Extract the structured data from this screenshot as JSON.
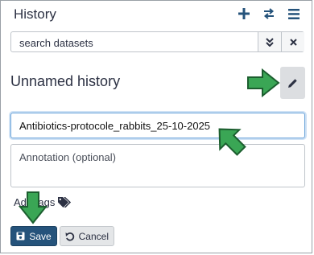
{
  "header": {
    "title": "History",
    "icons": [
      "plus-icon",
      "switch-icon",
      "menu-icon"
    ]
  },
  "search": {
    "placeholder": "search datasets",
    "icons": [
      "double-chevron-down-icon",
      "close-icon"
    ]
  },
  "history": {
    "name": "Unnamed history"
  },
  "editor": {
    "name_value": "Antibiotics-protocole_rabbits_25-10-2025",
    "annotation_placeholder": "Annotation (optional)",
    "tags_label": "Add tags",
    "save_label": "Save",
    "cancel_label": "Cancel"
  },
  "colors": {
    "primary": "#25537b",
    "annotation_arrow": "#2e9e4f"
  }
}
